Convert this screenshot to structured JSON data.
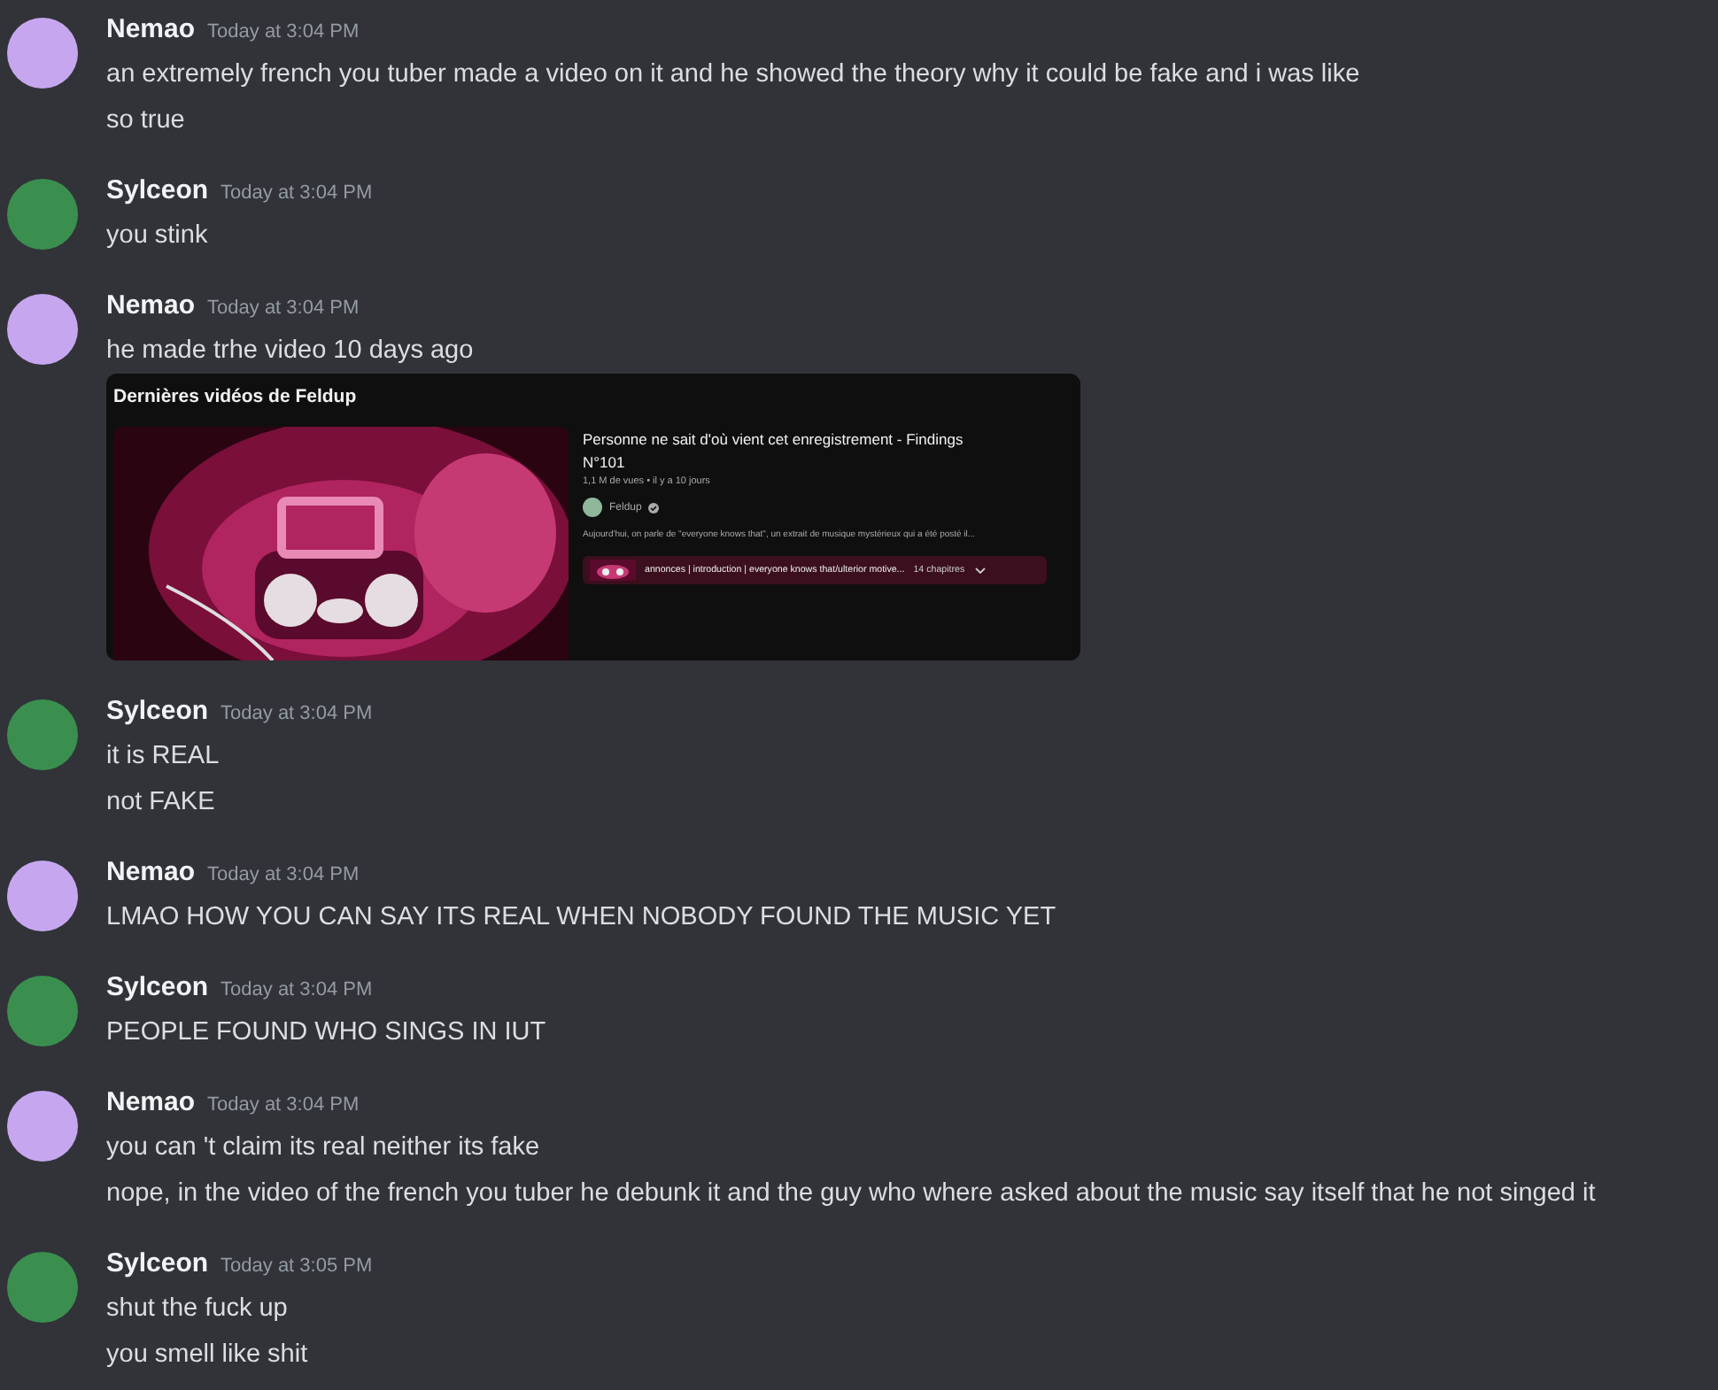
{
  "messages": [
    {
      "author": "Nemao",
      "color": "#c7a6f0",
      "time": "Today at 3:04 PM",
      "items": [
        {
          "kind": "text",
          "text": "an extremely french you tuber made a video on it and he showed the theory why it could be fake and i was like"
        },
        {
          "kind": "text",
          "text": "so true"
        }
      ]
    },
    {
      "author": "Sylceon",
      "color": "#3a8f4f",
      "time": "Today at 3:04 PM",
      "items": [
        {
          "kind": "text",
          "text": "you stink"
        }
      ]
    },
    {
      "author": "Nemao",
      "color": "#c7a6f0",
      "time": "Today at 3:04 PM",
      "items": [
        {
          "kind": "text",
          "text": "he made trhe video 10 days ago"
        },
        {
          "kind": "embed",
          "header": "Dernières vidéos de Feldup",
          "title": "Personne ne sait d'où vient cet enregistrement - Findings N°101",
          "meta": "1,1 M de vues • il y a 10 jours",
          "channel": "Feldup",
          "verified": true,
          "description": "Aujourd'hui, on parle de \"everyone knows that\", un extrait de musique mystérieux qui a été posté il...",
          "chapters": "annonces | introduction | everyone knows that/ulterior motive...",
          "chapter_count": "14 chapitres"
        }
      ]
    },
    {
      "author": "Sylceon",
      "color": "#3a8f4f",
      "time": "Today at 3:04 PM",
      "items": [
        {
          "kind": "text",
          "text": "it is REAL"
        },
        {
          "kind": "text",
          "text": "not FAKE"
        }
      ]
    },
    {
      "author": "Nemao",
      "color": "#c7a6f0",
      "time": "Today at 3:04 PM",
      "items": [
        {
          "kind": "text",
          "text": "LMAO HOW YOU CAN SAY ITS REAL WHEN NOBODY FOUND THE MUSIC YET"
        }
      ]
    },
    {
      "author": "Sylceon",
      "color": "#3a8f4f",
      "time": "Today at 3:04 PM",
      "items": [
        {
          "kind": "text",
          "text": "PEOPLE FOUND WHO SINGS IN IUT"
        }
      ]
    },
    {
      "author": "Nemao",
      "color": "#c7a6f0",
      "time": "Today at 3:04 PM",
      "items": [
        {
          "kind": "text",
          "text": "you can 't claim its real neither its fake"
        },
        {
          "kind": "text",
          "text": "nope, in the video of the french you tuber he debunk it and the guy who where asked about the  music say itself that he not singed it"
        }
      ]
    },
    {
      "author": "Sylceon",
      "color": "#3a8f4f",
      "time": "Today at 3:05 PM",
      "items": [
        {
          "kind": "text",
          "text": "shut the fuck up"
        },
        {
          "kind": "text",
          "text": "you smell like shit"
        }
      ]
    }
  ]
}
